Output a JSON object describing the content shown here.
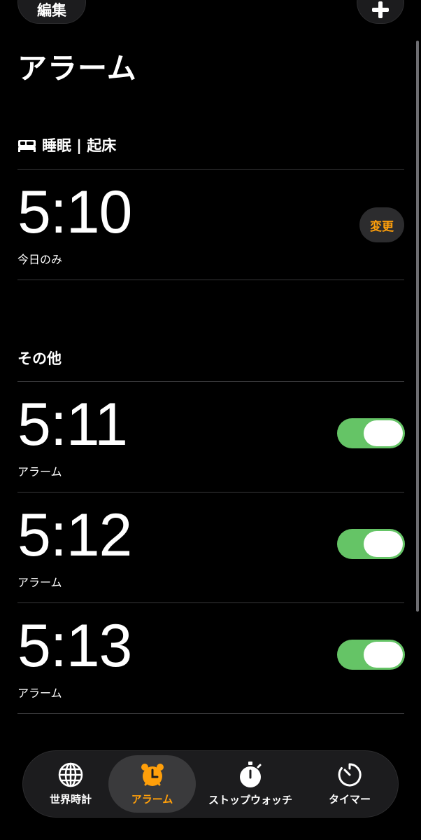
{
  "header": {
    "edit_label": "編集",
    "title": "アラーム"
  },
  "sleep_section": {
    "label": "睡眠 | 起床",
    "alarm": {
      "time": "5:10",
      "label": "今日のみ",
      "change_label": "変更"
    }
  },
  "other_section": {
    "label": "その他",
    "alarms": [
      {
        "time": "5:11",
        "label": "アラーム",
        "enabled": true
      },
      {
        "time": "5:12",
        "label": "アラーム",
        "enabled": true
      },
      {
        "time": "5:13",
        "label": "アラーム",
        "enabled": true
      }
    ]
  },
  "tabs": [
    {
      "label": "世界時計",
      "icon": "globe-icon",
      "active": false
    },
    {
      "label": "アラーム",
      "icon": "alarm-clock-icon",
      "active": true
    },
    {
      "label": "ストップウォッチ",
      "icon": "stopwatch-icon",
      "active": false
    },
    {
      "label": "タイマー",
      "icon": "timer-icon",
      "active": false
    }
  ],
  "colors": {
    "accent": "#ff9f0a",
    "toggle_on": "#65c466",
    "background": "#000000"
  }
}
